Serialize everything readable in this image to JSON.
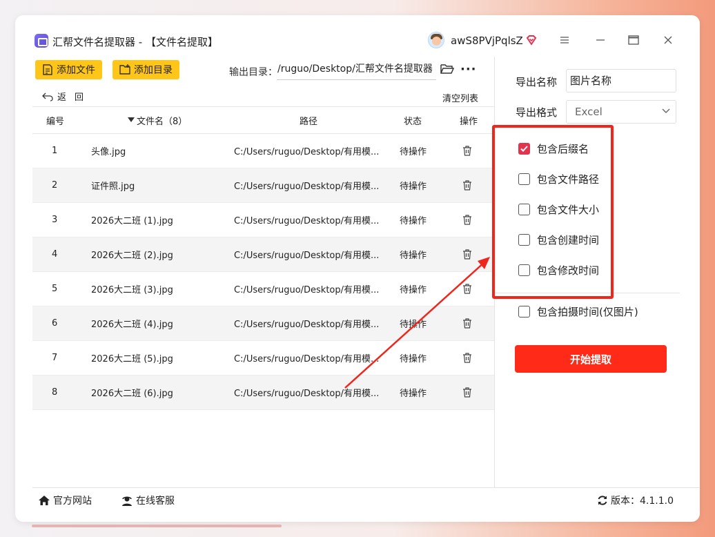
{
  "window": {
    "title": "汇帮文件名提取器 - 【文件名提取】",
    "username": "awS8PVjPqlsZ"
  },
  "toolbar": {
    "add_file": "添加文件",
    "add_dir": "添加目录",
    "output_label": "输出目录：",
    "output_path": "/ruguo/Desktop/汇帮文件名提取器",
    "back": "返回",
    "clear": "清空列表"
  },
  "table": {
    "headers": {
      "no": "编号",
      "name": "文件名（8）",
      "path": "路径",
      "state": "状态",
      "op": "操作"
    },
    "rows": [
      {
        "no": "1",
        "name": "头像.jpg",
        "path": "C:/Users/ruguo/Desktop/有用模...",
        "state": "待操作"
      },
      {
        "no": "2",
        "name": "证件照.jpg",
        "path": "C:/Users/ruguo/Desktop/有用模...",
        "state": "待操作"
      },
      {
        "no": "3",
        "name": "2026大二班 (1).jpg",
        "path": "C:/Users/ruguo/Desktop/有用模...",
        "state": "待操作"
      },
      {
        "no": "4",
        "name": "2026大二班 (2).jpg",
        "path": "C:/Users/ruguo/Desktop/有用模...",
        "state": "待操作"
      },
      {
        "no": "5",
        "name": "2026大二班 (3).jpg",
        "path": "C:/Users/ruguo/Desktop/有用模...",
        "state": "待操作"
      },
      {
        "no": "6",
        "name": "2026大二班 (4).jpg",
        "path": "C:/Users/ruguo/Desktop/有用模...",
        "state": "待操作"
      },
      {
        "no": "7",
        "name": "2026大二班 (5).jpg",
        "path": "C:/Users/ruguo/Desktop/有用模...",
        "state": "待操作"
      },
      {
        "no": "8",
        "name": "2026大二班 (6).jpg",
        "path": "C:/Users/ruguo/Desktop/有用模...",
        "state": "待操作"
      }
    ]
  },
  "settings": {
    "name_label": "导出名称",
    "name_value": "图片名称",
    "format_label": "导出格式",
    "format_value": "Excel",
    "options": [
      {
        "label": "包含后缀名",
        "checked": true
      },
      {
        "label": "包含文件路径",
        "checked": false
      },
      {
        "label": "包含文件大小",
        "checked": false
      },
      {
        "label": "包含创建时间",
        "checked": false
      },
      {
        "label": "包含修改时间",
        "checked": false
      },
      {
        "label": "包含拍摄时间(仅图片)",
        "checked": false
      }
    ],
    "start": "开始提取"
  },
  "statusbar": {
    "site": "官方网站",
    "support": "在线客服",
    "version": "版本：4.1.1.0"
  },
  "colors": {
    "accent_yellow": "#ffc619",
    "start_red": "#ff2a17",
    "check_red": "#e2334f",
    "annotation_red": "#f0251c"
  }
}
